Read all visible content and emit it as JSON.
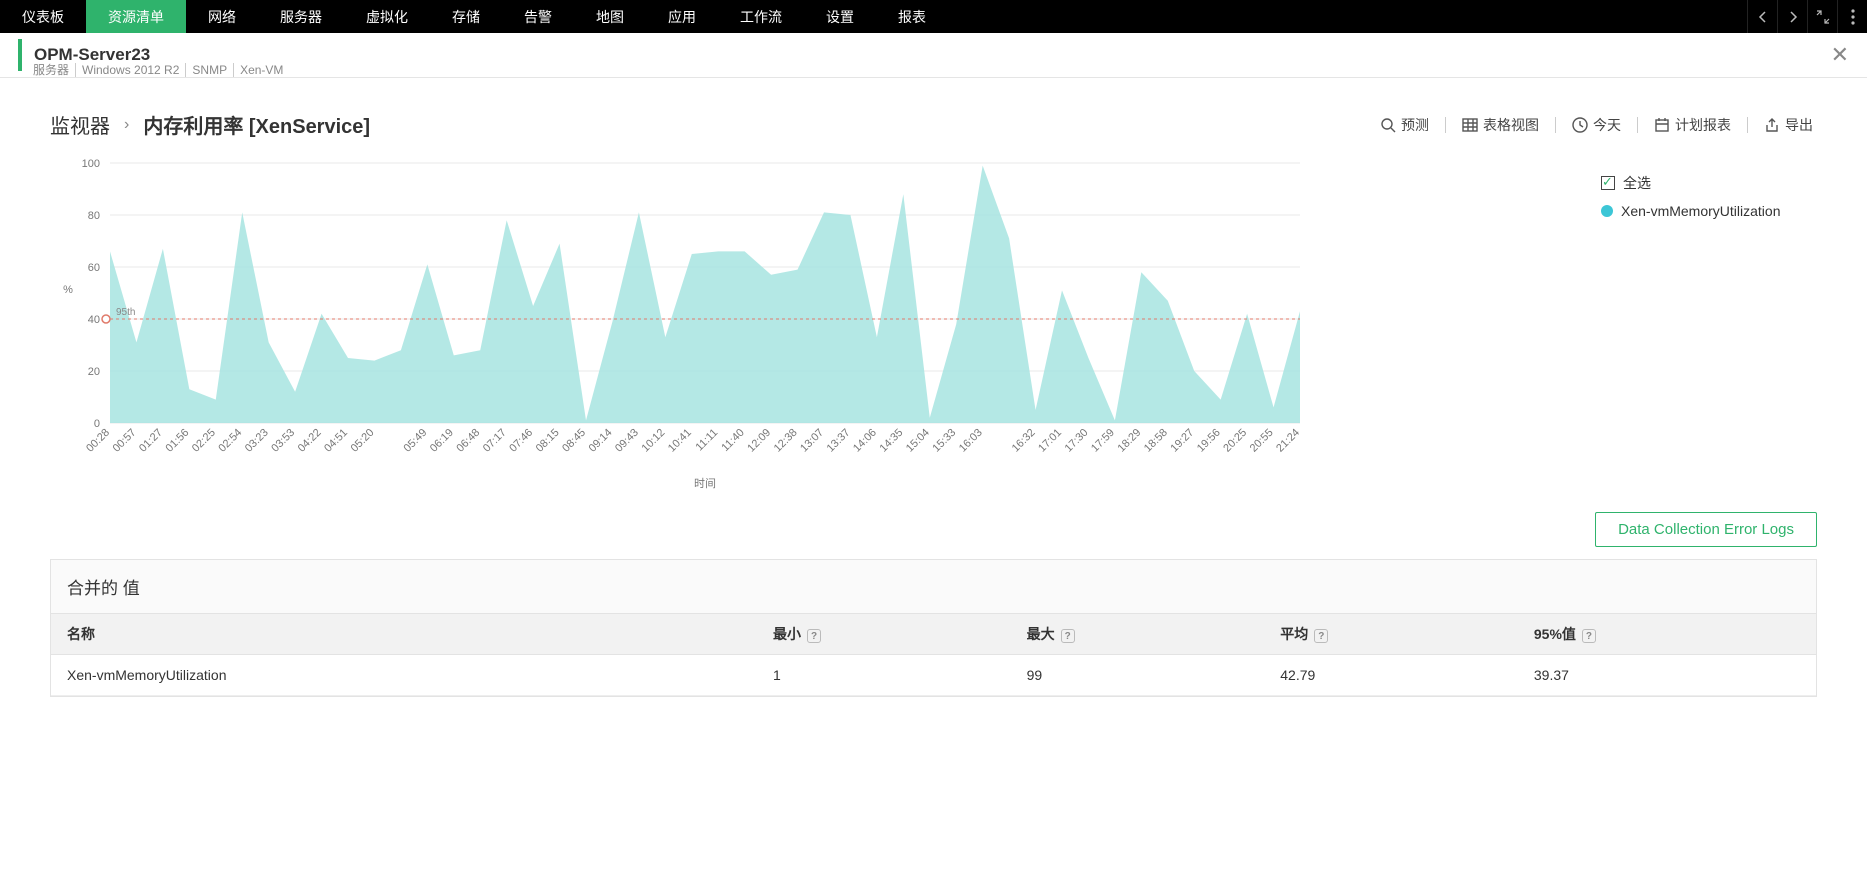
{
  "nav": {
    "items": [
      "仪表板",
      "资源清单",
      "网络",
      "服务器",
      "虚拟化",
      "存储",
      "告警",
      "地图",
      "应用",
      "工作流",
      "设置",
      "报表"
    ],
    "active_index": 1
  },
  "header": {
    "server_name": "OPM-Server23",
    "meta": [
      "服务器",
      "Windows 2012 R2",
      "SNMP",
      "Xen-VM"
    ]
  },
  "breadcrumb": {
    "parent": "监视器",
    "title": "内存利用率 [XenService]"
  },
  "actions": {
    "forecast": "预测",
    "table_view": "表格视图",
    "today": "今天",
    "schedule": "计划报表",
    "export": "导出"
  },
  "legend": {
    "select_all": "全选",
    "series_name": "Xen-vmMemoryUtilization",
    "series_color": "#3cc6d6"
  },
  "buttons": {
    "error_logs": "Data Collection Error Logs"
  },
  "table": {
    "caption": "合并的 值",
    "headers": {
      "name": "名称",
      "min": "最小",
      "max": "最大",
      "avg": "平均",
      "p95": "95%值"
    },
    "rows": [
      {
        "name": "Xen-vmMemoryUtilization",
        "min": "1",
        "max": "99",
        "avg": "42.79",
        "p95": "39.37"
      }
    ]
  },
  "chart_data": {
    "type": "area",
    "title": "",
    "xlabel": "时间",
    "ylabel": "%",
    "ylim": [
      0,
      100
    ],
    "p95_label": "95th",
    "p95_value": 40,
    "series": [
      {
        "name": "Xen-vmMemoryUtilization",
        "color": "#a7e4e0",
        "values": [
          66,
          31,
          67,
          13,
          9,
          81,
          31,
          12,
          42,
          25,
          24,
          28,
          61,
          26,
          28,
          78,
          45,
          69,
          1,
          39,
          81,
          33,
          65,
          66,
          66,
          57,
          59,
          81,
          80,
          33,
          88,
          2,
          38,
          99,
          71,
          5,
          51,
          25,
          1,
          58,
          47,
          20,
          9,
          42,
          6,
          43
        ]
      }
    ],
    "categories": [
      "00:28",
      "00:57",
      "01:27",
      "01:56",
      "02:25",
      "02:54",
      "03:23",
      "03:53",
      "04:22",
      "04:51",
      "05:20",
      "05:49",
      "06:19",
      "06:48",
      "07:17",
      "07:46",
      "08:15",
      "08:45",
      "09:14",
      "09:43",
      "10:12",
      "10:41",
      "11:11",
      "11:40",
      "12:09",
      "12:38",
      "13:07",
      "13:37",
      "14:06",
      "14:35",
      "15:04",
      "15:33",
      "16:03",
      "16:32",
      "17:01",
      "17:30",
      "17:59",
      "18:29",
      "18:58",
      "19:27",
      "19:56",
      "20:25",
      "20:55",
      "21:24"
    ]
  }
}
